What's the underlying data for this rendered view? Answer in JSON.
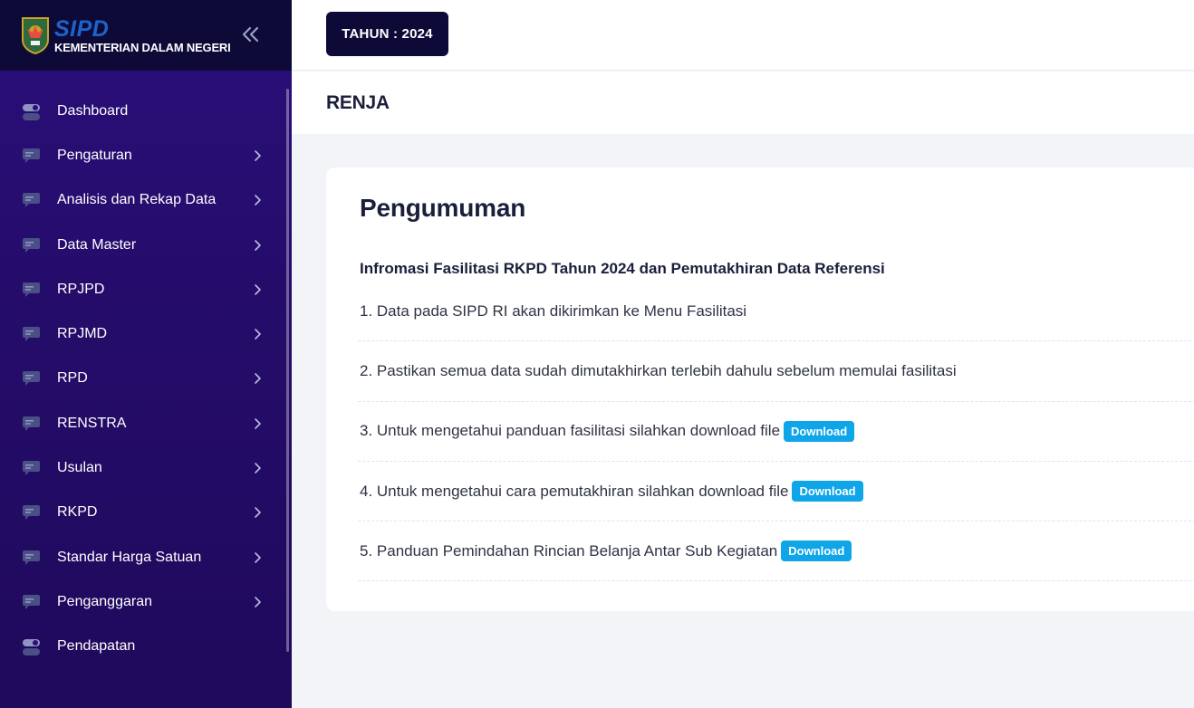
{
  "brand": {
    "title": "SIPD",
    "subtitle": "KEMENTERIAN DALAM NEGERI",
    "emblem_icon": "garuda-emblem-icon",
    "collapse_icon": "double-chevron-left-icon"
  },
  "sidebar": {
    "items": [
      {
        "label": "Dashboard",
        "icon": "toggle-icon",
        "has_submenu": false
      },
      {
        "label": "Pengaturan",
        "icon": "message-icon",
        "has_submenu": true
      },
      {
        "label": "Analisis dan Rekap Data",
        "icon": "message-icon",
        "has_submenu": true
      },
      {
        "label": "Data Master",
        "icon": "message-icon",
        "has_submenu": true
      },
      {
        "label": "RPJPD",
        "icon": "message-icon",
        "has_submenu": true
      },
      {
        "label": "RPJMD",
        "icon": "message-icon",
        "has_submenu": true
      },
      {
        "label": "RPD",
        "icon": "message-icon",
        "has_submenu": true
      },
      {
        "label": "RENSTRA",
        "icon": "message-icon",
        "has_submenu": true
      },
      {
        "label": "Usulan",
        "icon": "message-icon",
        "has_submenu": true
      },
      {
        "label": "RKPD",
        "icon": "message-icon",
        "has_submenu": true
      },
      {
        "label": "Standar Harga Satuan",
        "icon": "message-icon",
        "has_submenu": true
      },
      {
        "label": "Penganggaran",
        "icon": "message-icon",
        "has_submenu": true
      },
      {
        "label": "Pendapatan",
        "icon": "toggle-icon",
        "has_submenu": false
      }
    ]
  },
  "topbar": {
    "year_label": "TAHUN : 2024"
  },
  "page": {
    "title": "RENJA"
  },
  "announcement": {
    "title": "Pengumuman",
    "subtitle": "Infromasi Fasilitasi RKPD Tahun 2024 dan Pemutakhiran Data Referensi",
    "items": [
      {
        "text": "1. Data pada SIPD RI akan dikirimkan ke Menu Fasilitasi",
        "button": ""
      },
      {
        "text": "2. Pastikan semua data sudah dimutakhirkan terlebih dahulu sebelum memulai fasilitasi",
        "button": ""
      },
      {
        "text": "3. Untuk mengetahui panduan fasilitasi silahkan download file",
        "button": "Download"
      },
      {
        "text": "4. Untuk mengetahui cara pemutakhiran silahkan download file",
        "button": "Download"
      },
      {
        "text": "5. Panduan Pemindahan Rincian Belanja Antar Sub Kegiatan",
        "button": "Download"
      }
    ]
  },
  "colors": {
    "sidebar_bg": "#250c6b",
    "brand_bg": "#0d0a38",
    "accent": "#0ea5e9",
    "brand_blue": "#1e63c9"
  }
}
